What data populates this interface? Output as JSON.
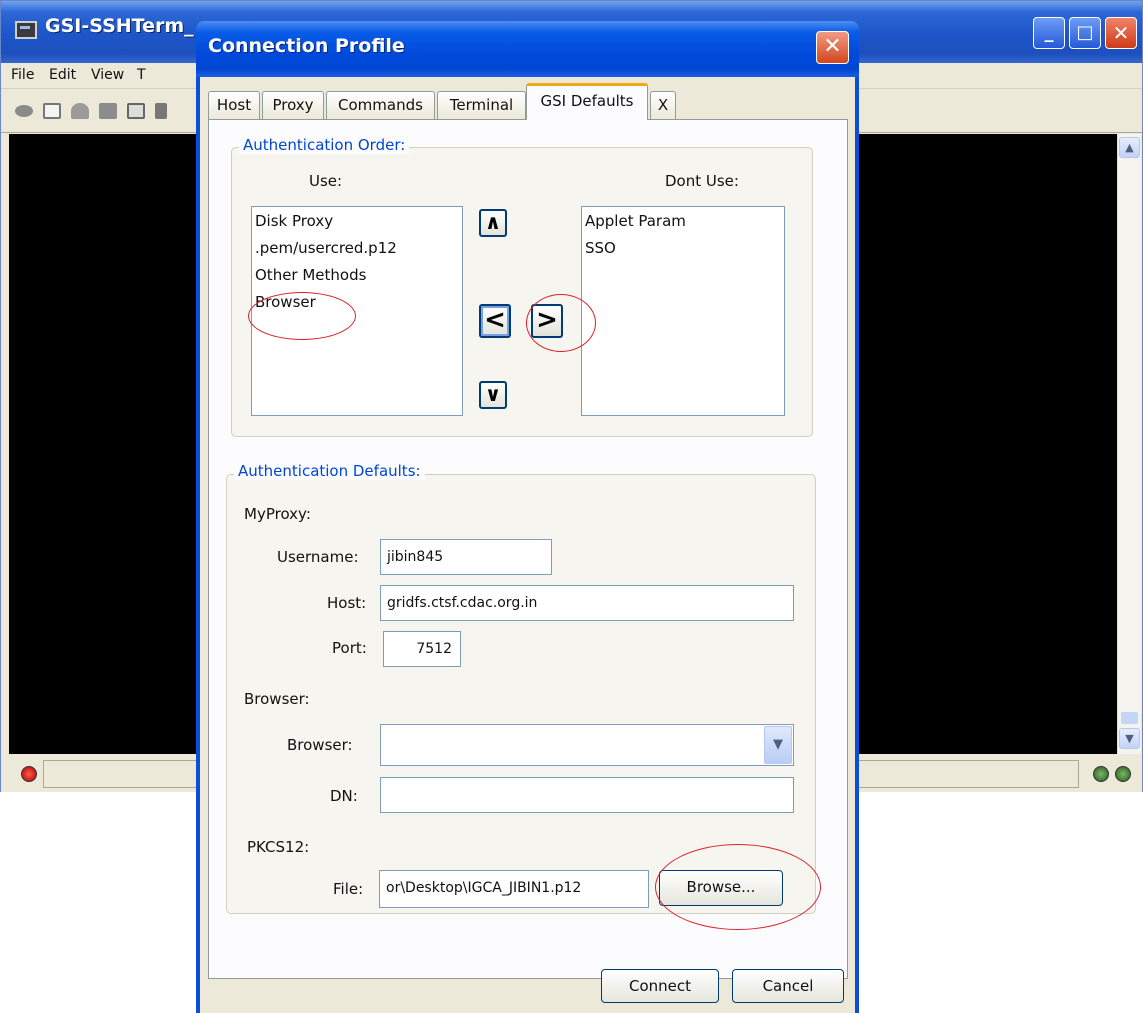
{
  "main_window": {
    "title": "GSI-SSHTerm_",
    "menu": [
      "File",
      "Edit",
      "View",
      "T"
    ],
    "buttons": {
      "minimize": "_",
      "maximize": "□",
      "close": "✕"
    }
  },
  "dialog": {
    "title": "Connection Profile",
    "close_label": "✕",
    "tabs": [
      {
        "label": "Host"
      },
      {
        "label": "Proxy"
      },
      {
        "label": "Commands"
      },
      {
        "label": "Terminal"
      },
      {
        "label": "GSI Defaults"
      },
      {
        "label": "X"
      }
    ],
    "auth_order": {
      "legend": "Authentication Order:",
      "use_label": "Use:",
      "dont_use_label": "Dont Use:",
      "use_items": [
        "Disk Proxy",
        ".pem/usercred.p12",
        "Other Methods",
        "Browser"
      ],
      "dont_use_items": [
        "Applet Param",
        "SSO"
      ],
      "btn_up": "∧",
      "btn_left": "<",
      "btn_right": ">",
      "btn_down": "∨"
    },
    "auth_defaults": {
      "legend": "Authentication Defaults:",
      "myproxy_label": "MyProxy:",
      "username_label": "Username:",
      "username_value": "jibin845",
      "host_label": "Host:",
      "host_value": "gridfs.ctsf.cdac.org.in",
      "port_label": "Port:",
      "port_value": "7512",
      "browser_section_label": "Browser:",
      "browser_label": "Browser:",
      "browser_value": "",
      "dn_label": "DN:",
      "dn_value": "",
      "pkcs12_label": "PKCS12:",
      "file_label": "File:",
      "file_value": "or\\Desktop\\IGCA_JIBIN1.p12",
      "browse_label": "Browse..."
    },
    "connect_label": "Connect",
    "cancel_label": "Cancel"
  },
  "colors": {
    "annotation": "#d8232a",
    "legend": "#0046d5",
    "titlebar": "#0a5ce8"
  }
}
